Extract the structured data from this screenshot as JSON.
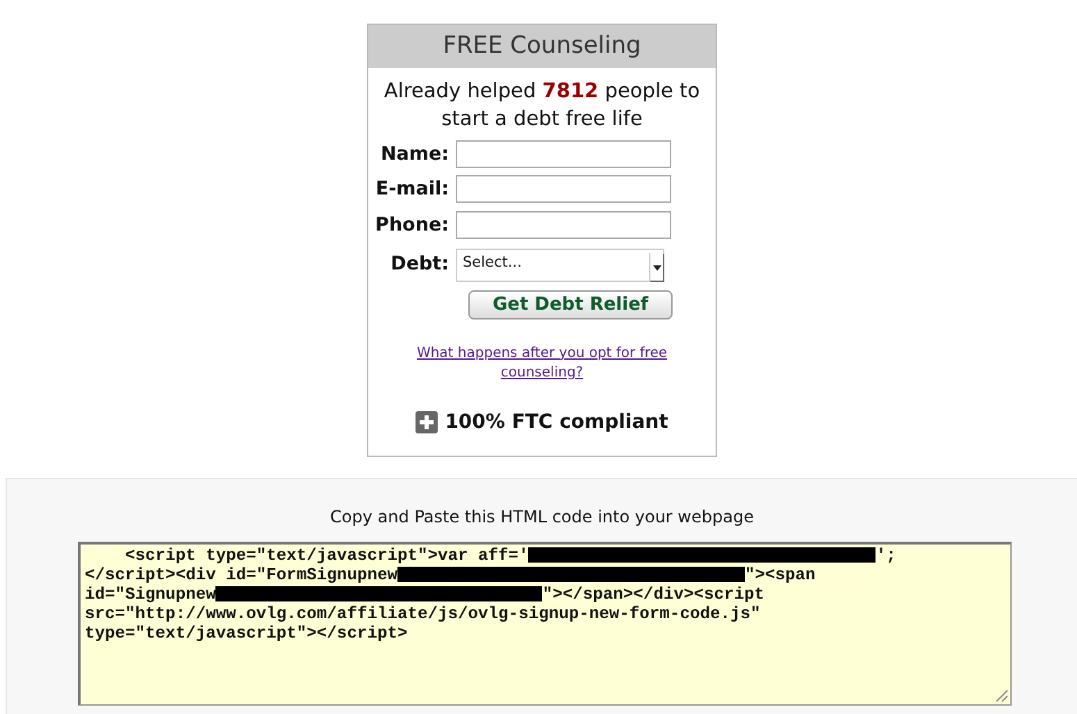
{
  "signup_card": {
    "title": "FREE Counseling",
    "tagline": "Already helped **7812** people to start a debt free life",
    "fields": [
      {
        "label": "Name:",
        "kind": "text"
      },
      {
        "label": "E-mail:",
        "kind": "text"
      },
      {
        "label": "Phone:",
        "kind": "text"
      },
      {
        "label": "Debt:",
        "kind": "select",
        "value": "Select..."
      }
    ],
    "submit": "Get Debt Relief",
    "info_link": "What happens after you opt for free counseling?",
    "compliance": "100% FTC compliant"
  },
  "embed": {
    "instruction": "Copy and Paste this HTML code into your webpage",
    "code_lines": [
      [
        {
          "kind": "text",
          "text": "    <script type=\"text/javascript\">var aff='"
        },
        {
          "kind": "redacted"
        },
        {
          "kind": "text",
          "text": "';"
        }
      ],
      [
        {
          "kind": "text",
          "text": "</script><div id=\"FormSignupnew"
        },
        {
          "kind": "redacted"
        },
        {
          "kind": "text",
          "text": "\"><span"
        }
      ],
      [
        {
          "kind": "text",
          "text": "id=\"Signupnew"
        },
        {
          "kind": "redacted"
        },
        {
          "kind": "text",
          "text": "\"></span></div><script"
        }
      ],
      [
        {
          "kind": "text",
          "text": "src=\"http://www.ovlg.com/affiliate/js/ovlg-signup-new-form-code.js\""
        }
      ],
      [
        {
          "kind": "text",
          "text": "type=\"text/javascript\"></script>"
        }
      ]
    ]
  }
}
